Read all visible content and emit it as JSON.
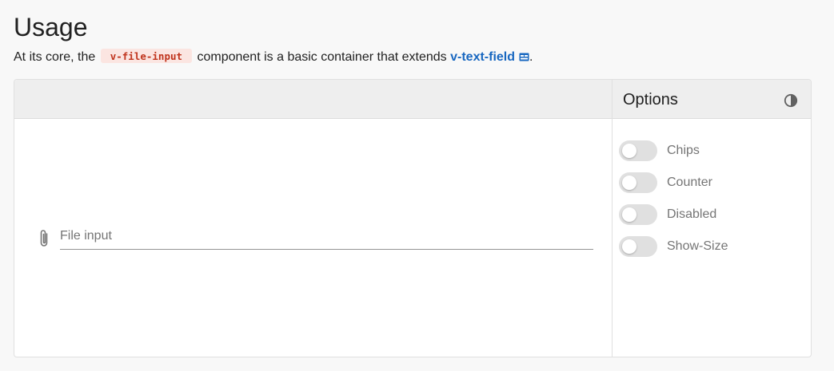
{
  "header": {
    "title": "Usage",
    "intro_before": "At its core, the",
    "component_code": "v-file-input",
    "intro_middle": "component is a basic container that extends",
    "link_text": "v-text-field",
    "intro_end": "."
  },
  "playground": {
    "options_title": "Options",
    "theme_icon": "contrast-icon",
    "file_input": {
      "label": "File input",
      "icon": "paperclip-icon"
    },
    "options": [
      {
        "label": "Chips",
        "on": false
      },
      {
        "label": "Counter",
        "on": false
      },
      {
        "label": "Disabled",
        "on": false
      },
      {
        "label": "Show-Size",
        "on": false
      }
    ]
  },
  "colors": {
    "link": "#1867c0",
    "code_text": "#c0341d",
    "code_bg": "#fbe5e1",
    "switch_track": "#e0e0e0"
  }
}
